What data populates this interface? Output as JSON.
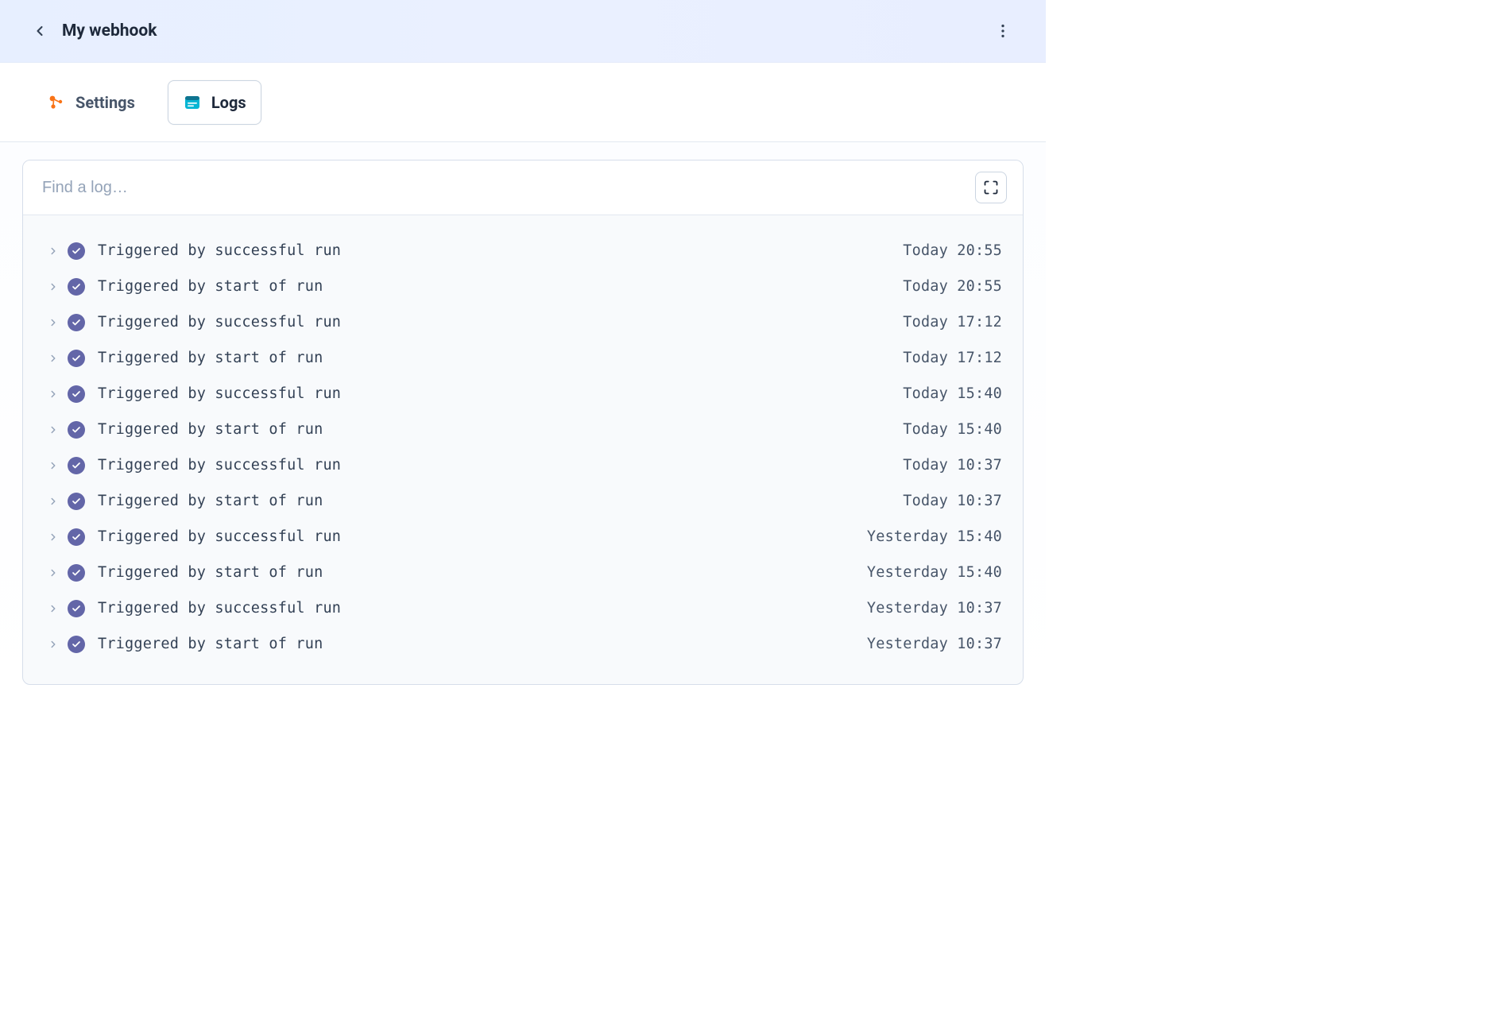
{
  "header": {
    "title": "My webhook"
  },
  "tabs": {
    "settings": {
      "label": "Settings"
    },
    "logs": {
      "label": "Logs",
      "active": true
    }
  },
  "search": {
    "placeholder": "Find a log…"
  },
  "logs": [
    {
      "status": "success",
      "message": "Triggered by successful run",
      "time": "Today 20:55"
    },
    {
      "status": "success",
      "message": "Triggered by start of run",
      "time": "Today 20:55"
    },
    {
      "status": "success",
      "message": "Triggered by successful run",
      "time": "Today 17:12"
    },
    {
      "status": "success",
      "message": "Triggered by start of run",
      "time": "Today 17:12"
    },
    {
      "status": "success",
      "message": "Triggered by successful run",
      "time": "Today 15:40"
    },
    {
      "status": "success",
      "message": "Triggered by start of run",
      "time": "Today 15:40"
    },
    {
      "status": "success",
      "message": "Triggered by successful run",
      "time": "Today 10:37"
    },
    {
      "status": "success",
      "message": "Triggered by start of run",
      "time": "Today 10:37"
    },
    {
      "status": "success",
      "message": "Triggered by successful run",
      "time": "Yesterday 15:40"
    },
    {
      "status": "success",
      "message": "Triggered by start of run",
      "time": "Yesterday 15:40"
    },
    {
      "status": "success",
      "message": "Triggered by successful run",
      "time": "Yesterday 10:37"
    },
    {
      "status": "success",
      "message": "Triggered by start of run",
      "time": "Yesterday 10:37"
    }
  ]
}
